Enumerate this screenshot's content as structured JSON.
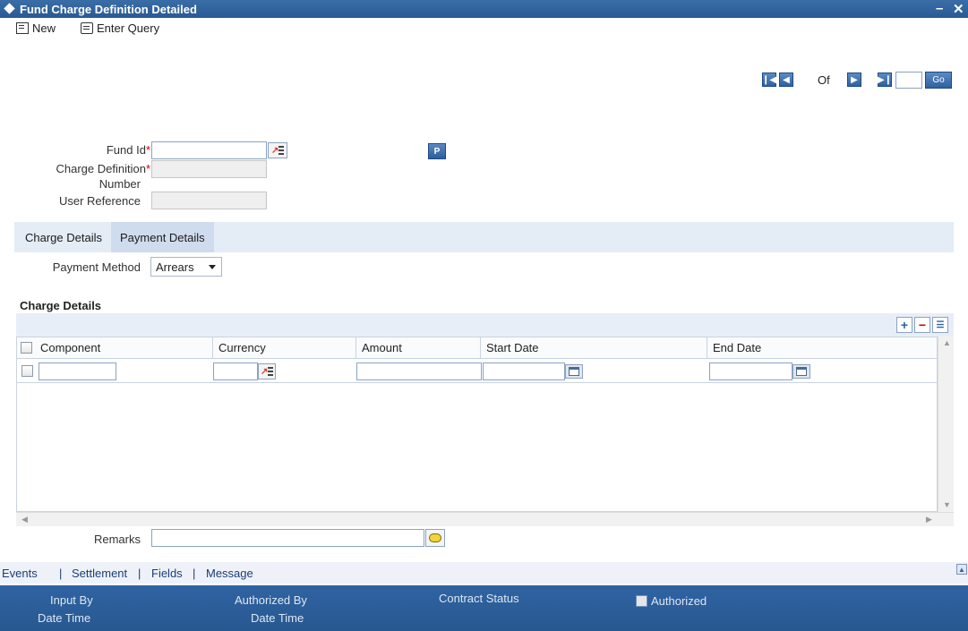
{
  "window": {
    "title": "Fund Charge Definition Detailed",
    "minimize": "–",
    "close": "✕"
  },
  "toolbar": {
    "new_label": "New",
    "enter_query_label": "Enter Query"
  },
  "pager": {
    "of_label": "Of",
    "go_label": "Go",
    "current": "",
    "total": ""
  },
  "form": {
    "fund_id_label": "Fund Id",
    "fund_id_value": "",
    "charge_def_label_1": "Charge Definition",
    "charge_def_label_2": "Number",
    "charge_def_value": "",
    "user_ref_label": "User Reference",
    "user_ref_value": "",
    "p_button": "P",
    "required_mark": "*"
  },
  "tabs": [
    {
      "label": "Charge Details"
    },
    {
      "label": "Payment Details"
    }
  ],
  "payment": {
    "method_label": "Payment Method",
    "method_value": "Arrears"
  },
  "charge_details": {
    "section_title": "Charge Details",
    "columns": [
      "Component",
      "Currency",
      "Amount",
      "Start Date",
      "End Date"
    ],
    "rows": [
      {
        "component": "",
        "currency": "",
        "amount": "",
        "start_date": "",
        "end_date": ""
      }
    ]
  },
  "remarks": {
    "label": "Remarks",
    "value": ""
  },
  "footer_links": [
    "Events",
    "Settlement",
    "Fields",
    "Message"
  ],
  "footer_separator": "|",
  "footer": {
    "input_by": "Input By",
    "date_time": "Date Time",
    "authorized_by": "Authorized By",
    "contract_status": "Contract Status",
    "authorized": "Authorized"
  },
  "colors": {
    "title_bar": "#2a5a92",
    "footer_bar": "#2f63a2",
    "tab_bar": "#e4ecf6",
    "required": "#cc0000"
  }
}
